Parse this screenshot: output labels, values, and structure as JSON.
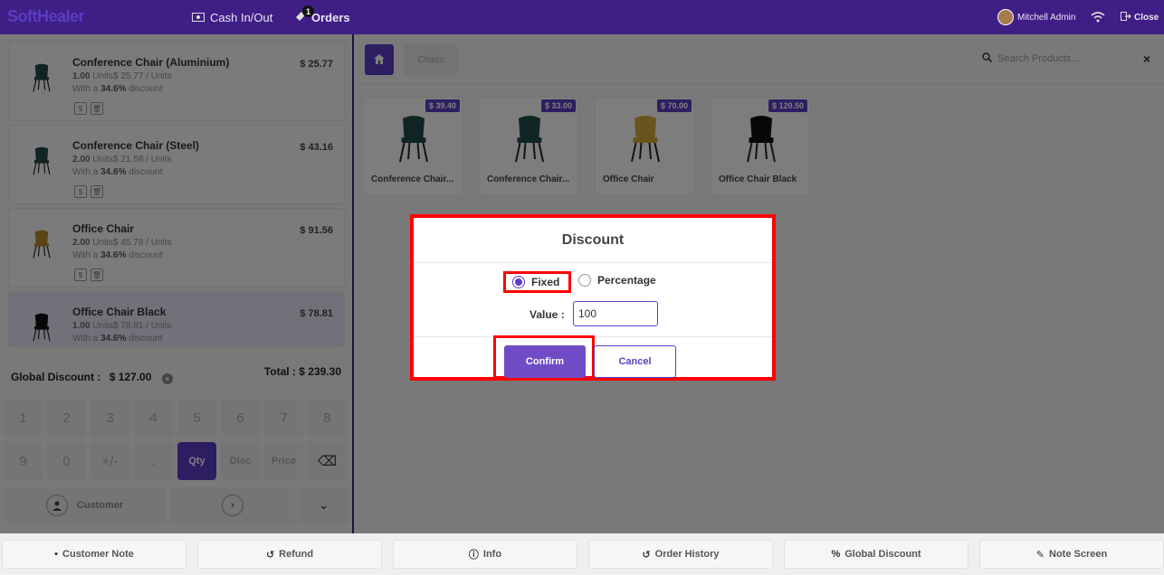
{
  "app": {
    "logo": "SoftHealer"
  },
  "topbar": {
    "cash_label": "Cash In/Out",
    "orders_label": "Orders",
    "orders_badge": "1",
    "user_name": "Mitchell Admin",
    "close_label": "Close"
  },
  "order_lines": [
    {
      "name": "Conference Chair (Aluminium)",
      "price": "$ 25.77",
      "qty": "1.00",
      "unit_info": "Units$ 25.77 / Units",
      "discount_prefix": "With a",
      "discount": "34.6%",
      "discount_suffix": "discount",
      "chair_color": "#1f4a48"
    },
    {
      "name": "Conference Chair (Steel)",
      "price": "$ 43.16",
      "qty": "2.00",
      "unit_info": "Units$ 21.58 / Units",
      "discount_prefix": "With a",
      "discount": "34.6%",
      "discount_suffix": "discount",
      "chair_color": "#1f4a48"
    },
    {
      "name": "Office Chair",
      "price": "$ 91.56",
      "qty": "2.00",
      "unit_info": "Units$ 45.78 / Units",
      "discount_prefix": "With a",
      "discount": "34.6%",
      "discount_suffix": "discount",
      "chair_color": "#b78a2a"
    },
    {
      "name": "Office Chair Black",
      "price": "$ 78.81",
      "qty": "1.00",
      "unit_info": "Units$ 78.81 / Units",
      "discount_prefix": "With a",
      "discount": "34.6%",
      "discount_suffix": "discount",
      "chair_color": "#111111"
    }
  ],
  "summary": {
    "global_discount_label": "Global Discount :",
    "global_discount_value": "$ 127.00",
    "total_label": "Total :",
    "total_value": "$ 239.30"
  },
  "numpad": {
    "keys_row1": [
      "1",
      "2",
      "3",
      "4",
      "5",
      "6",
      "7",
      "8"
    ],
    "keys_row2": [
      "9",
      "0",
      "+/-",
      ".",
      "Qty",
      "Disc",
      "Price",
      "⌫"
    ],
    "customer_label": "Customer"
  },
  "products_header": {
    "breadcrumb": "Chairs",
    "search_placeholder": "Search Products..."
  },
  "products": [
    {
      "name": "Conference Chair...",
      "price": "$ 39.40",
      "chair_color": "#1f4a48"
    },
    {
      "name": "Conference Chair...",
      "price": "$ 33.00",
      "chair_color": "#1f4a48"
    },
    {
      "name": "Office Chair",
      "price": "$ 70.00",
      "chair_color": "#d1a83a"
    },
    {
      "name": "Office Chair Black",
      "price": "$ 120.50",
      "chair_color": "#111111"
    }
  ],
  "bottom_buttons": [
    {
      "label": "Customer Note",
      "icon": "note-icon"
    },
    {
      "label": "Refund",
      "icon": "undo-icon"
    },
    {
      "label": "Info",
      "icon": "info-icon"
    },
    {
      "label": "Order History",
      "icon": "history-icon"
    },
    {
      "label": "Global Discount",
      "icon": "percent-icon"
    },
    {
      "label": "Note Screen",
      "icon": "edit-icon"
    }
  ],
  "dialog": {
    "title": "Discount",
    "option_fixed": "Fixed",
    "option_percentage": "Percentage",
    "selected_option": "Fixed",
    "value_label": "Value :",
    "value": "100",
    "confirm_label": "Confirm",
    "cancel_label": "Cancel"
  },
  "colors": {
    "brand": "#3f1f86",
    "accent": "#5b3dc4",
    "highlight": "#ff0000"
  }
}
